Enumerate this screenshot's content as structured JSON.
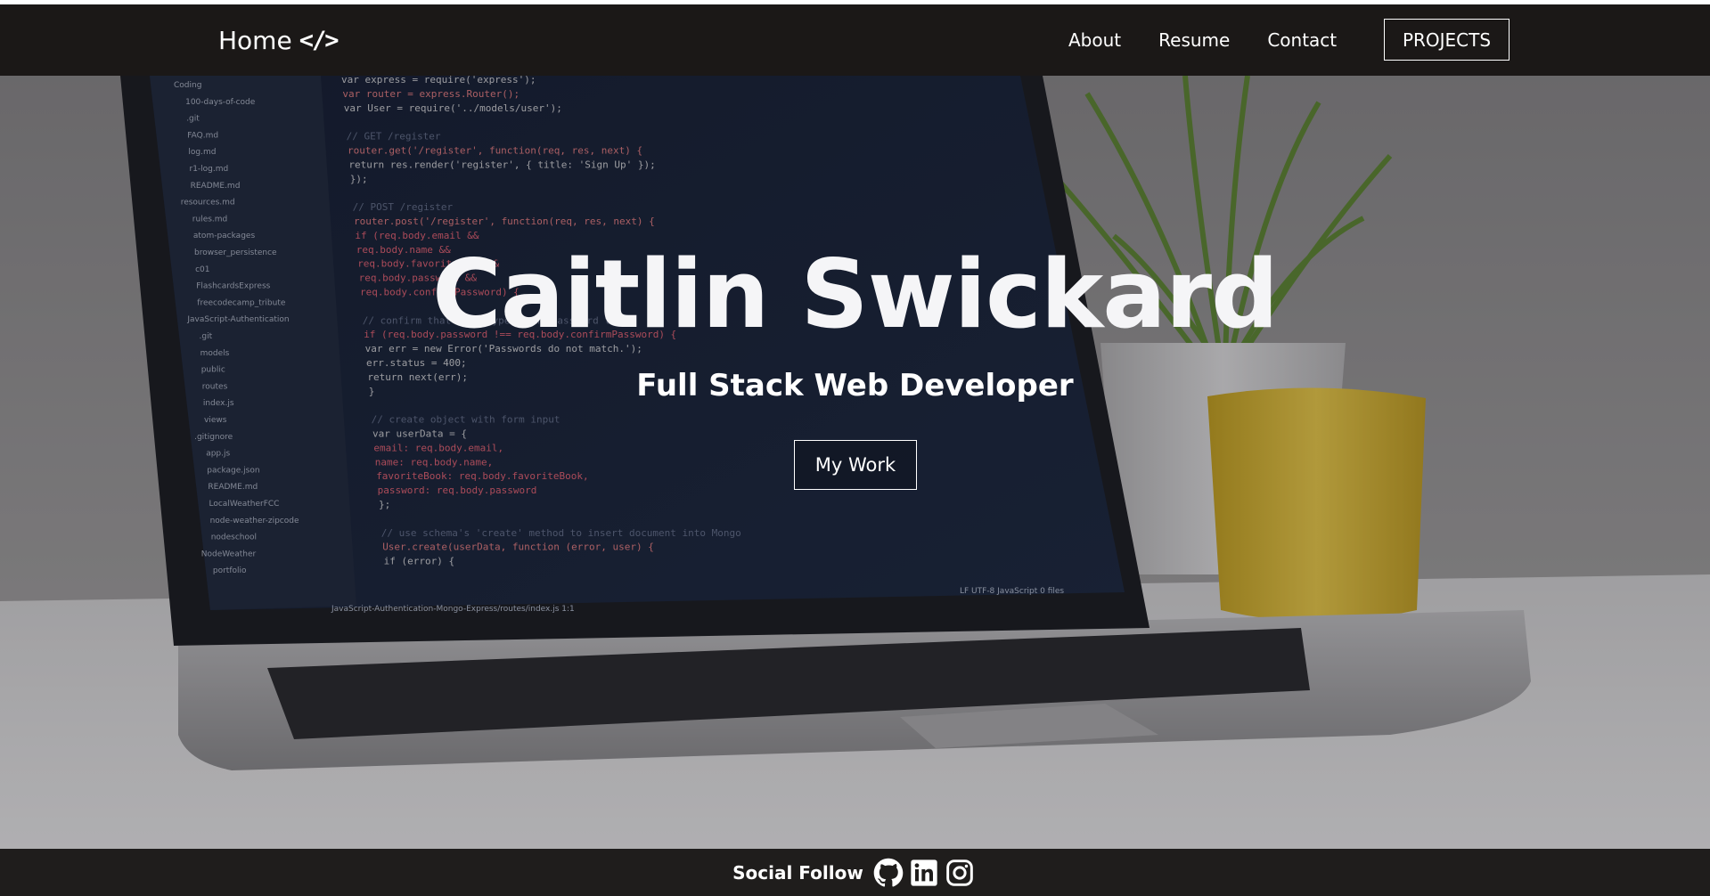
{
  "nav": {
    "brand_label": "Home",
    "brand_icon": "</>",
    "links": [
      "About",
      "Resume",
      "Contact"
    ],
    "projects_label": "PROJECTS"
  },
  "hero": {
    "title": "Caitlin Swickard",
    "subtitle": "Full Stack Web Developer",
    "cta_label": "My Work"
  },
  "footer": {
    "social_label": "Social Follow",
    "icons": [
      "github-icon",
      "linkedin-icon",
      "instagram-icon"
    ]
  },
  "colors": {
    "navbar_bg": "#1b1817",
    "footer_bg": "#1f1d1c",
    "text": "#ffffff"
  },
  "code_screen": {
    "sidebar_items": [
      "Coding",
      "100-days-of-code",
      ".git",
      "FAQ.md",
      "log.md",
      "r1-log.md",
      "README.md",
      "resources.md",
      "rules.md",
      "atom-packages",
      "browser_persistence",
      "c01",
      "FlashcardsExpress",
      "freecodecamp_tribute",
      "JavaScript-Authentication",
      ".git",
      "models",
      "public",
      "routes",
      "index.js",
      "views",
      ".gitignore",
      "app.js",
      "package.json",
      "README.md",
      "LocalWeatherFCC",
      "node-weather-zipcode",
      "nodeschool",
      "NodeWeather",
      "portfolio"
    ],
    "code_lines": [
      "var express = require('express');",
      "var router = express.Router();",
      "var User = require('../models/user');",
      "",
      "// GET /register",
      "router.get('/register', function(req, res, next) {",
      "  return res.render('register', { title: 'Sign Up' });",
      "});",
      "",
      "// POST /register",
      "router.post('/register', function(req, res, next) {",
      "  if (req.body.email &&",
      "    req.body.name &&",
      "    req.body.favoriteBook &&",
      "    req.body.password &&",
      "    req.body.confirmPassword) {",
      "",
      "    // confirm that user typed same password twice",
      "    if (req.body.password !== req.body.confirmPassword) {",
      "      var err = new Error('Passwords do not match.');",
      "      err.status = 400;",
      "      return next(err);",
      "    }",
      "",
      "    // create object with form input",
      "    var userData = {",
      "      email: req.body.email,",
      "      name: req.body.name,",
      "      favoriteBook: req.body.favoriteBook,",
      "      password: req.body.password",
      "    };",
      "",
      "    // use schema's 'create' method to insert document into Mongo",
      "    User.create(userData, function (error, user) {",
      "      if (error) {"
    ],
    "status_bar_path": "JavaScript-Authentication-Mongo-Express/routes/index.js",
    "status_bar_pos": "1:1",
    "status_bar_right": [
      "LF",
      "UTF-8",
      "JavaScript",
      "0 files"
    ]
  }
}
